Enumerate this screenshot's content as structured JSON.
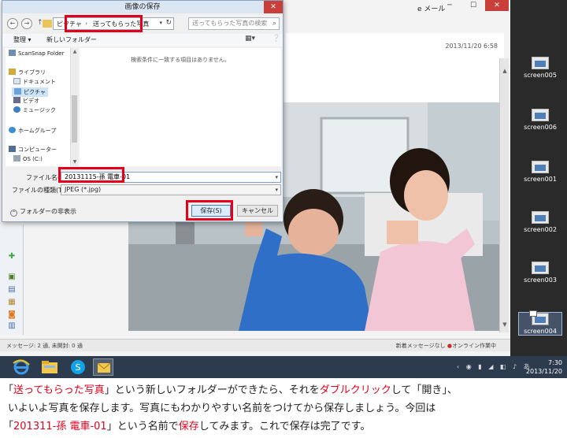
{
  "mail_window": {
    "title_suffix": "e メール",
    "date": "2013/11/20 6:58",
    "status_left": "メッセージ: 2 通, 未開封: 0 通",
    "status_right_prefix": "新着メッセージなし",
    "status_right_online": "オンライン作業中"
  },
  "desktop": {
    "icons": [
      "screen005",
      "screen006",
      "screen001",
      "screen002",
      "screen003",
      "screen004"
    ]
  },
  "dialog": {
    "title": "画像の保存",
    "breadcrumb": [
      "ピクチャ",
      "送ってもらった写真"
    ],
    "search_placeholder": "送ってもらった写真の検索",
    "toolbar": {
      "organize": "整理 ▾",
      "new_folder": "新しいフォルダー"
    },
    "nav_items": [
      {
        "label": "ScanSnap Folder",
        "icon": "scanner-icon"
      },
      {
        "label": "ライブラリ",
        "icon": "library-icon"
      },
      {
        "label": "ドキュメント",
        "icon": "document-icon"
      },
      {
        "label": "ピクチャ",
        "icon": "picture-icon",
        "selected": true
      },
      {
        "label": "ビデオ",
        "icon": "video-icon"
      },
      {
        "label": "ミュージック",
        "icon": "music-icon"
      },
      {
        "label": "ホームグループ",
        "icon": "homegroup-icon"
      },
      {
        "label": "コンピューター",
        "icon": "computer-icon"
      },
      {
        "label": "OS (C:)",
        "icon": "drive-icon"
      }
    ],
    "empty_message": "検索条件に一致する項目はありません。",
    "filename_label": "ファイル名(N):",
    "filename_value": "20131115-孫 電車-01",
    "filetype_label": "ファイルの種類(T):",
    "filetype_value": "JPEG (*.jpg)",
    "hide_folders": "フォルダーの非表示",
    "save_label": "保存(S)",
    "cancel_label": "キャンセル"
  },
  "taskbar": {
    "time": "7:30",
    "date": "2013/11/20"
  },
  "caption": {
    "line1_a": "「",
    "line1_red1": "送ってもらった写真",
    "line1_b": "」という新しいフォルダーができたら、それを",
    "line1_red2": "ダブルクリック",
    "line1_c": "して「開き」、",
    "line2": "いよいよ写真を保存します。写真にもわかりやすい名前をつけてから保存しましょう。今回は",
    "line3_a": "「",
    "line3_red1": "201311-孫 電車-01",
    "line3_b": "」という名前で",
    "line3_red2": "保存",
    "line3_c": "してみます。これで保存は完了です。"
  }
}
